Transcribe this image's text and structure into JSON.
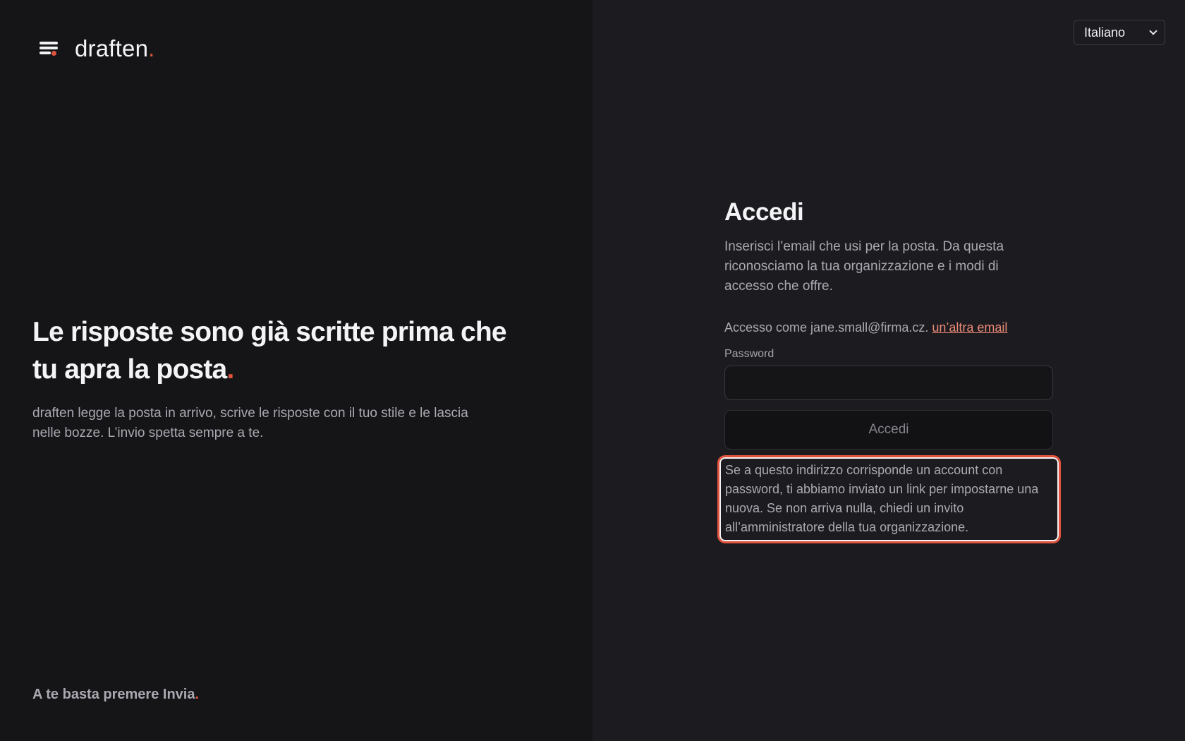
{
  "brand": {
    "name": "draften",
    "accent_mark": ".",
    "accent_color": "#e2533d",
    "icon": "menu-lines-icon"
  },
  "hero": {
    "headline": "Le risposte sono già scritte prima che tu apra la posta",
    "headline_mark": ".",
    "subtext": "draften legge la posta in arrivo, scrive le risposte con il tuo stile e le lascia nelle bozze. L’invio spetta sempre a te.",
    "footer": "A te basta premere Invia",
    "footer_mark": "."
  },
  "language": {
    "selected": "Italiano",
    "icon": "chevron-down-icon"
  },
  "login": {
    "title": "Accedi",
    "description": "Inserisci l’email che usi per la posta. Da questa riconosciamo la tua organizzazione e i modi di accesso che offre.",
    "account_prefix": "Accesso come jane.small@firma.cz.",
    "change_email_link": "un’altra email",
    "password_label": "Password",
    "password_value": "",
    "submit_label": "Accedi",
    "notice": "Se a questo indirizzo corrisponde un account con password, ti abbiamo inviato un link per impostarne una nuova. Se non arriva nulla, chiedi un invito all’amministratore della tua organizzazione."
  }
}
